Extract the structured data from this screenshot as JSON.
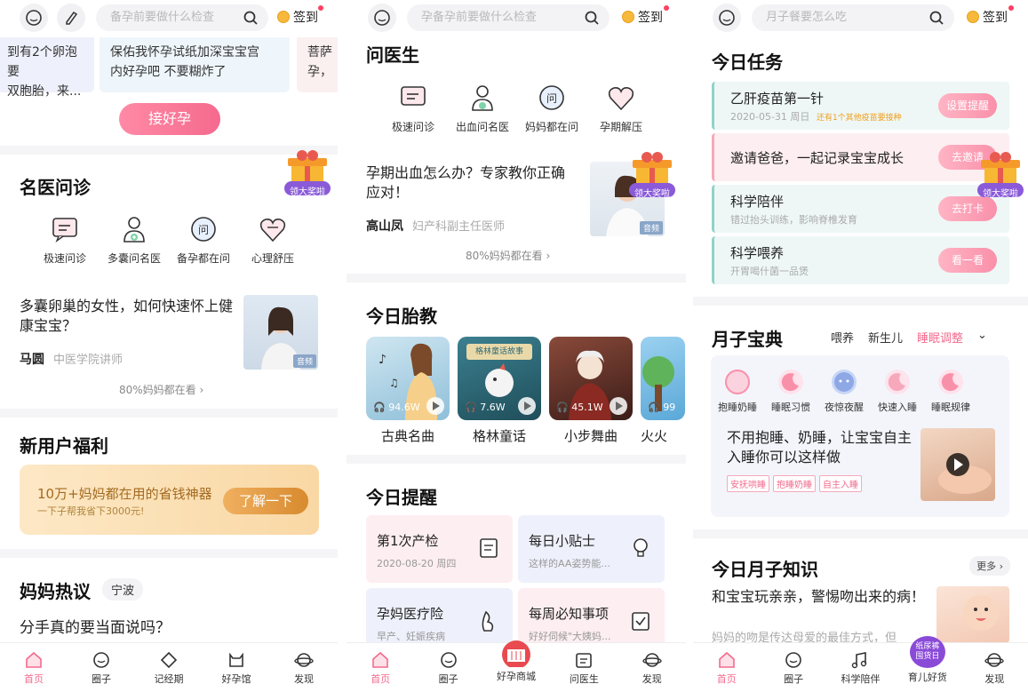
{
  "s1": {
    "search_placeholder": "备孕前要做什么检查",
    "signin": "签到",
    "card_left": "到有2个卵泡要\n双胞胎，来...",
    "card_mid": "保佑我怀孕试纸加深宝宝宫\n内好孕吧  不要糊炸了",
    "card_right": "菩萨\n孕，",
    "pink_button": "接好孕",
    "sec_doctor": "名医问诊",
    "gift_label": "领大奖啦",
    "icons": [
      "极速问诊",
      "多囊问名医",
      "备孕都在问",
      "心理舒压"
    ],
    "article_title": "多囊卵巢的女性，如何快速怀上健康宝宝？",
    "article_author": "马圆",
    "article_role": "中医学院讲师",
    "article_tag": "音频",
    "readers": "80%妈妈都在看",
    "sec_benefit": "新用户福利",
    "benefit_l1": "10万+妈妈都在用的省钱神器",
    "benefit_l2": "一下子帮我省下3000元!",
    "benefit_btn": "了解一下",
    "sec_hot": "妈妈热议",
    "city": "宁波",
    "hot_question": "分手真的要当面说吗？",
    "nav": [
      "首页",
      "圈子",
      "记经期",
      "好孕馆",
      "发现"
    ]
  },
  "s2": {
    "search_placeholder": "孕备孕前要做什么检查",
    "signin": "签到",
    "sec_doctor": "问医生",
    "icons": [
      "极速问诊",
      "出血问名医",
      "妈妈都在问",
      "孕期解压"
    ],
    "article_title": "孕期出血怎么办？专家教你正确应对！",
    "article_author": "高山凤",
    "article_role": "妇产科副主任医师",
    "article_tag": "音频",
    "gift_label": "领大奖啦",
    "readers": "80%妈妈都在看",
    "sec_music": "今日胎教",
    "music": [
      {
        "label": "古典名曲",
        "count": "94.6W",
        "color": "#8fbfd9"
      },
      {
        "label": "格林童话",
        "count": "7.6W",
        "color": "#2e6a78"
      },
      {
        "label": "小步舞曲",
        "count": "45.1W",
        "color": "#5a2e2a"
      },
      {
        "label": "火火",
        "count": "99",
        "color": "#5aa8d8"
      }
    ],
    "music_card2_title": "格林童话故事",
    "sec_remind": "今日提醒",
    "reminders": [
      {
        "title": "第1次产检",
        "sub": "2020-08-20 周四"
      },
      {
        "title": "每日小贴士",
        "sub": "这样的AA姿势能..."
      },
      {
        "title": "孕妈医疗险",
        "sub": "早产、妊娠疾病"
      },
      {
        "title": "每周必知事项",
        "sub": "好好伺候\"大姨妈..."
      }
    ],
    "nav": [
      "首页",
      "圈子",
      "好孕商城",
      "问医生",
      "发现"
    ]
  },
  "s3": {
    "search_placeholder": "月子餐要怎么吃",
    "signin": "签到",
    "sec_task": "今日任务",
    "tasks": [
      {
        "title": "乙肝疫苗第一针",
        "sub": "2020-05-31 周日",
        "extra": "还有1个其他疫苗要接种",
        "btn": "设置提醒"
      },
      {
        "title": "邀请爸爸，一起记录宝宝成长",
        "sub": "",
        "extra": "",
        "btn": "去邀请"
      },
      {
        "title": "科学陪伴",
        "sub": "错过抬头训练，影响脊椎发育",
        "extra": "",
        "btn": "去打卡"
      },
      {
        "title": "科学喂养",
        "sub": "开胃喝什菌一品煲",
        "extra": "",
        "btn": "看一看"
      }
    ],
    "gift_label": "领大奖啦",
    "sec_book": "月子宝典",
    "tabs": [
      "喂养",
      "新生儿",
      "睡眠调整"
    ],
    "book_icons": [
      "抱睡奶睡",
      "睡眠习惯",
      "夜惊夜醒",
      "快速入睡",
      "睡眠规律"
    ],
    "book_title": "不用抱睡、奶睡，让宝宝自主入睡你可以这样做",
    "chips": [
      "安抚哄睡",
      "抱睡奶睡",
      "自主入睡"
    ],
    "sec_knowledge": "今日月子知识",
    "more": "更多",
    "knowledge_title": "和宝宝玩亲亲，警惕吻出来的病！",
    "knowledge_sub": "妈妈的吻是传达母爱的最佳方式，但",
    "badge": "纸尿裤\n囤货日",
    "nav": [
      "首页",
      "圈子",
      "科学陪伴",
      "育儿好货",
      "发现"
    ]
  },
  "colors": {
    "accent": "#f36b8e",
    "gold": "#d88a2e"
  }
}
